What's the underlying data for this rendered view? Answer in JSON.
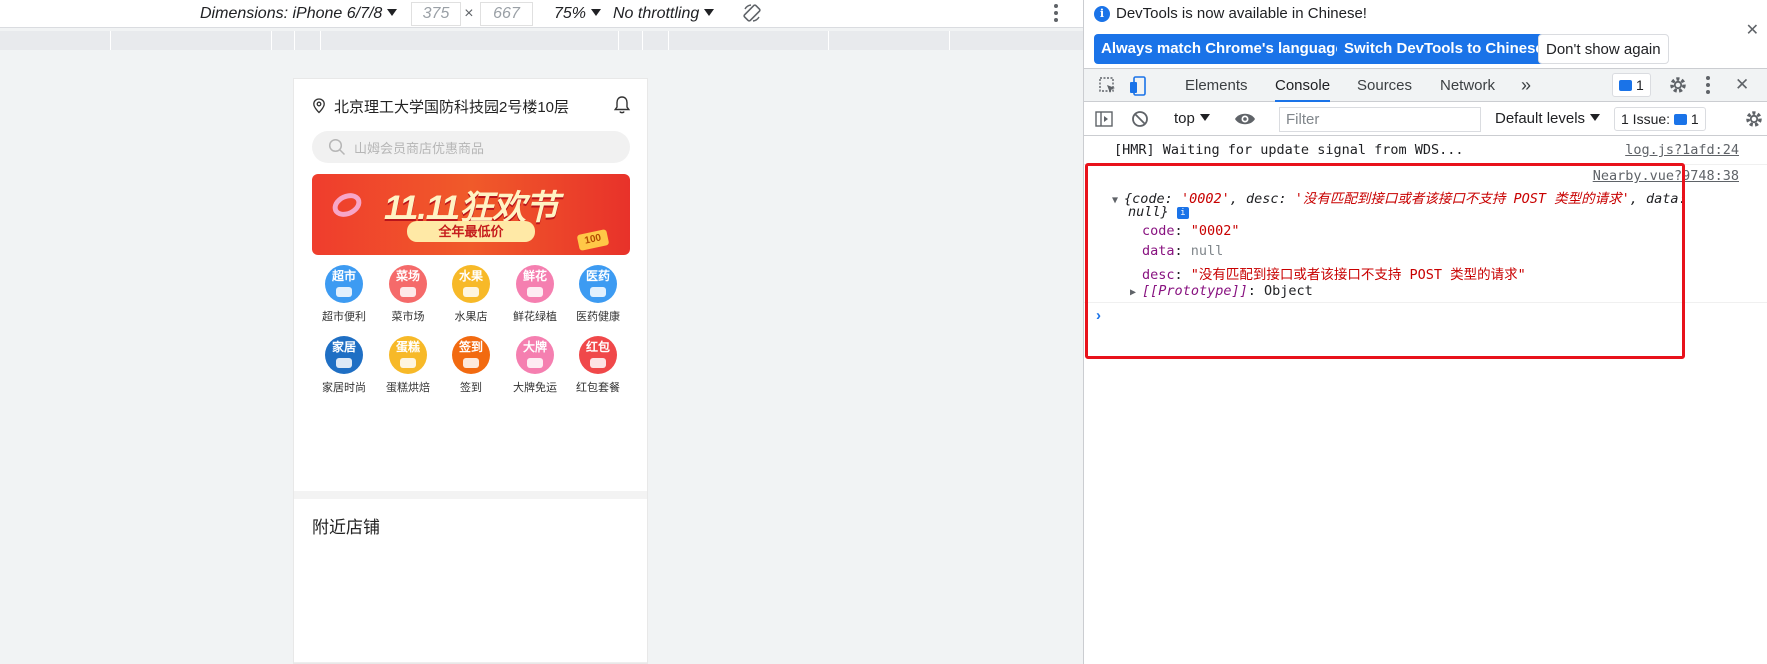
{
  "device_toolbar": {
    "dimensions_label": "Dimensions: iPhone 6/7/8",
    "width": "375",
    "times": "×",
    "height": "667",
    "zoom": "75%",
    "throttling": "No throttling"
  },
  "phone": {
    "address": "北京理工大学国防科技园2号楼10层",
    "search_placeholder": "山姆会员商店优惠商品",
    "banner_title": "11.11狂欢节",
    "banner_subtitle": "全年最低价",
    "banner_coin": "100",
    "categories": [
      {
        "icon_text": "超市",
        "label": "超市便利",
        "color": "#3d9bf2"
      },
      {
        "icon_text": "菜场",
        "label": "菜市场",
        "color": "#f56a6a"
      },
      {
        "icon_text": "水果",
        "label": "水果店",
        "color": "#f7b928"
      },
      {
        "icon_text": "鲜花",
        "label": "鲜花绿植",
        "color": "#f57fb0"
      },
      {
        "icon_text": "医药",
        "label": "医药健康",
        "color": "#3d9bf2"
      },
      {
        "icon_text": "家居",
        "label": "家居时尚",
        "color": "#1f6fc4"
      },
      {
        "icon_text": "蛋糕",
        "label": "蛋糕烘焙",
        "color": "#f7b928"
      },
      {
        "icon_text": "签到",
        "label": "签到",
        "color": "#f26a10"
      },
      {
        "icon_text": "大牌",
        "label": "大牌免运",
        "color": "#f57fb0"
      },
      {
        "icon_text": "红包",
        "label": "红包套餐",
        "color": "#f0484a"
      }
    ],
    "section_title": "附近店铺"
  },
  "devtools": {
    "notice": "DevTools is now available in Chinese!",
    "btn_match": "Always match Chrome's language",
    "btn_switch": "Switch DevTools to Chinese",
    "btn_dismiss": "Don't show again",
    "tabs": [
      "Elements",
      "Console",
      "Sources",
      "Network"
    ],
    "more_tabs": "»",
    "messages_count": "1",
    "context": "top",
    "filter_placeholder": "Filter",
    "levels": "Default levels",
    "issues_label": "1 Issue:",
    "issues_count": "1",
    "log1_text": "[HMR] Waiting for update signal from WDS...",
    "log1_src": "log.js?1afd:24",
    "log2_src": "Nearby.vue?9748:38",
    "obj_summary_a": "{code: ",
    "obj_code_val": "'0002'",
    "obj_summary_b": ", desc: ",
    "obj_desc_val": "'没有匹配到接口或者该接口不支持 POST 类型的请求'",
    "obj_summary_c": ", data:",
    "obj_summary_d": "null}",
    "prop_code_key": "code",
    "prop_code_val": "\"0002\"",
    "prop_data_key": "data",
    "prop_data_val": "null",
    "prop_desc_key": "desc",
    "prop_desc_val": "\"没有匹配到接口或者该接口不支持 POST 类型的请求\"",
    "proto_key": "[[Prototype]]",
    "proto_val": "Object",
    "prompt": "›"
  }
}
